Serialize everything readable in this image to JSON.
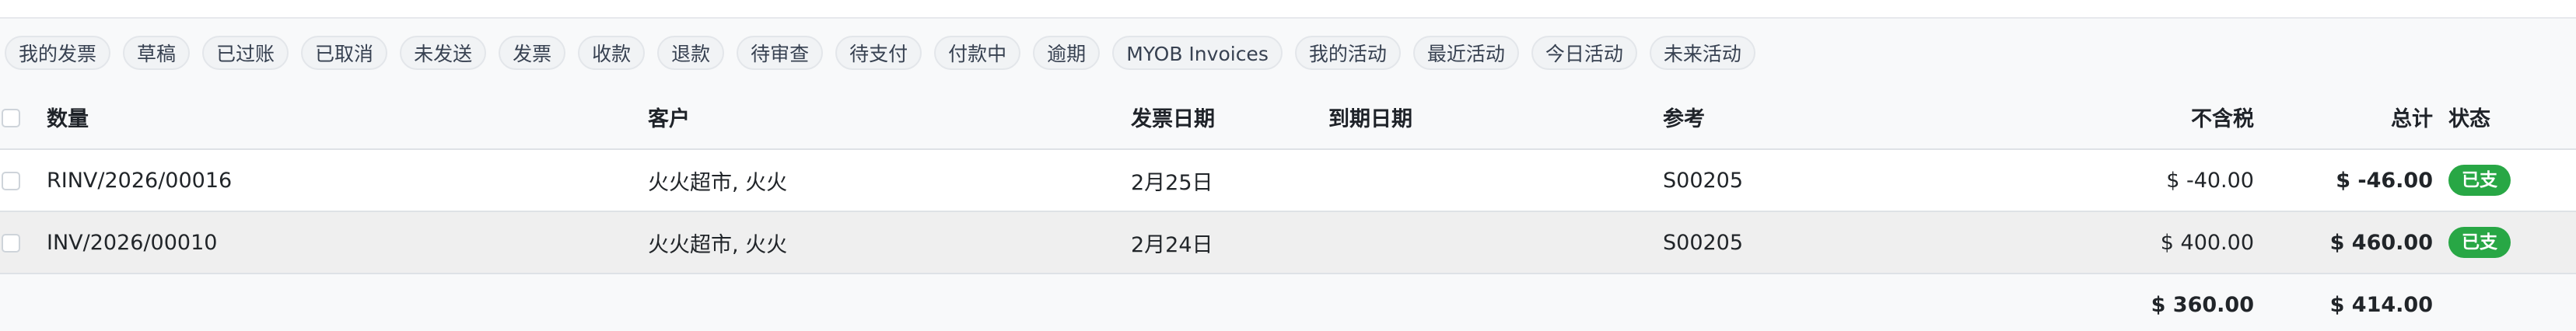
{
  "filters": [
    "我的发票",
    "草稿",
    "已过账",
    "已取消",
    "未发送",
    "发票",
    "收款",
    "退款",
    "待审查",
    "待支付",
    "付款中",
    "逾期",
    "MYOB Invoices",
    "我的活动",
    "最近活动",
    "今日活动",
    "未来活动"
  ],
  "table": {
    "headers": {
      "number": "数量",
      "customer": "客户",
      "invoice_date": "发票日期",
      "due_date": "到期日期",
      "reference": "参考",
      "untaxed": "不含税",
      "total": "总计",
      "status": "状态"
    },
    "rows": [
      {
        "number": "RINV/2026/00016",
        "customer": "火火超市, 火火",
        "invoice_date": "2月25日",
        "due_date": "",
        "reference": "S00205",
        "untaxed": "$ -40.00",
        "total": "$ -46.00",
        "status": "已支"
      },
      {
        "number": "INV/2026/00010",
        "customer": "火火超市, 火火",
        "invoice_date": "2月24日",
        "due_date": "",
        "reference": "S00205",
        "untaxed": "$ 400.00",
        "total": "$ 460.00",
        "status": "已支"
      }
    ],
    "totals": {
      "untaxed": "$ 360.00",
      "total": "$ 414.00"
    }
  },
  "colors": {
    "paid_badge": "#28a745",
    "chip_bg": "#f1f3f5"
  }
}
